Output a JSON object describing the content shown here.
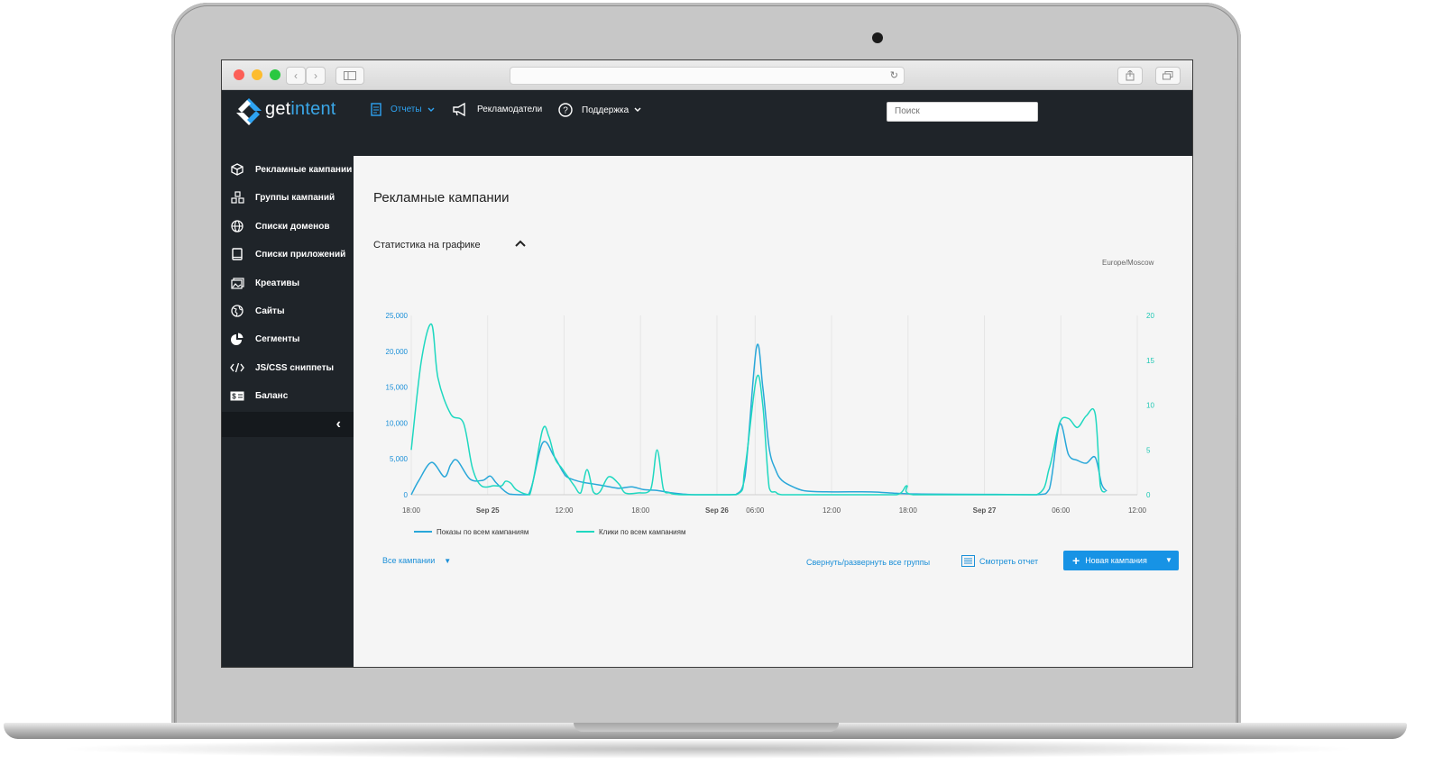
{
  "brand": {
    "name_prefix": "get",
    "name_suffix": "intent"
  },
  "topnav": [
    {
      "label": "Отчеты",
      "icon": "document-icon",
      "active": true,
      "has_dropdown": true
    },
    {
      "label": "Рекламодатели",
      "icon": "megaphone-icon",
      "active": false,
      "has_dropdown": false
    },
    {
      "label": "Поддержка",
      "icon": "help-circle-icon",
      "active": false,
      "has_dropdown": true
    }
  ],
  "search": {
    "placeholder": "Поиск"
  },
  "sidebar": {
    "items": [
      {
        "label": "Рекламные кампании",
        "icon": "cube-icon"
      },
      {
        "label": "Группы кампаний",
        "icon": "cubes-icon"
      },
      {
        "label": "Списки доменов",
        "icon": "globe-icon"
      },
      {
        "label": "Списки приложений",
        "icon": "tablet-icon"
      },
      {
        "label": "Креативы",
        "icon": "image-icon"
      },
      {
        "label": "Сайты",
        "icon": "earth-icon"
      },
      {
        "label": "Сегменты",
        "icon": "pie-icon"
      },
      {
        "label": "JS/CSS сниппеты",
        "icon": "code-icon"
      },
      {
        "label": "Баланс",
        "icon": "money-icon"
      }
    ],
    "collapse_icon": "chevron-left-icon"
  },
  "main": {
    "title": "Рекламные кампании",
    "stats_section_title": "Статистика на графике",
    "timezone": "Europe/Moscow",
    "filter_label": "Все кампании",
    "toggle_groups_label": "Свернуть/развернуть все группы",
    "view_report_label": "Смотреть отчет",
    "new_campaign_label": "Новая кампания"
  },
  "colors": {
    "accent": "#1793e5",
    "series_impressions": "#29a7d9",
    "series_clicks": "#1fd8c0",
    "dark_bg": "#1f2429"
  },
  "chart_data": {
    "type": "line",
    "x_ticks": [
      "18:00",
      "Sep 25",
      "12:00",
      "18:00",
      "Sep 26",
      "06:00",
      "12:00",
      "18:00",
      "Sep 27",
      "06:00",
      "12:00"
    ],
    "x_range_hours": [
      0,
      57
    ],
    "y_left": {
      "ticks": [
        "0",
        "5,000",
        "10,000",
        "15,000",
        "20,000",
        "25,000"
      ],
      "ylim": [
        0,
        25000
      ]
    },
    "y_right": {
      "ticks": [
        "0",
        "5",
        "10",
        "15",
        "20"
      ],
      "ylim": [
        0,
        20
      ]
    },
    "grid": true,
    "legend_position": "bottom-left",
    "series": [
      {
        "name": "Показы по всем кампаниям",
        "axis": "left",
        "points": [
          [
            0,
            0
          ],
          [
            0.6,
            2000
          ],
          [
            1.6,
            4500
          ],
          [
            2.6,
            2500
          ],
          [
            3.1,
            4200
          ],
          [
            3.6,
            4800
          ],
          [
            4.6,
            2200
          ],
          [
            5.6,
            2000
          ],
          [
            6.2,
            2600
          ],
          [
            6.7,
            1600
          ],
          [
            7.7,
            100
          ],
          [
            9.2,
            0
          ],
          [
            10.3,
            7200
          ],
          [
            11.2,
            5400
          ],
          [
            11.9,
            3200
          ],
          [
            12.3,
            2400
          ],
          [
            13.3,
            1800
          ],
          [
            14.3,
            1500
          ],
          [
            15.3,
            1200
          ],
          [
            16.3,
            900
          ],
          [
            17.3,
            1100
          ],
          [
            18.3,
            700
          ],
          [
            19.3,
            600
          ],
          [
            20.3,
            300
          ],
          [
            21.3,
            100
          ],
          [
            22.3,
            0
          ],
          [
            24.5,
            0
          ],
          [
            25.5,
            50
          ],
          [
            26.2,
            2500
          ],
          [
            27.1,
            20500
          ],
          [
            27.6,
            15000
          ],
          [
            28.1,
            6500
          ],
          [
            28.6,
            3500
          ],
          [
            29.1,
            2000
          ],
          [
            30.1,
            1000
          ],
          [
            31.1,
            500
          ],
          [
            33.1,
            400
          ],
          [
            36.1,
            400
          ],
          [
            38.1,
            200
          ],
          [
            40.1,
            100
          ],
          [
            45.1,
            50
          ],
          [
            49.1,
            0
          ],
          [
            50.1,
            800
          ],
          [
            50.9,
            9800
          ],
          [
            51.6,
            5600
          ],
          [
            52.3,
            4800
          ],
          [
            53.0,
            4400
          ],
          [
            53.7,
            5200
          ],
          [
            54.2,
            1500
          ],
          [
            54.6,
            500
          ]
        ]
      },
      {
        "name": "Клики по всем кампаниям",
        "axis": "right",
        "points": [
          [
            0,
            5
          ],
          [
            0.8,
            15
          ],
          [
            1.6,
            19
          ],
          [
            2.1,
            13
          ],
          [
            3.1,
            9
          ],
          [
            4.1,
            8
          ],
          [
            4.8,
            3
          ],
          [
            5.5,
            1
          ],
          [
            6.5,
            1
          ],
          [
            7.1,
            1
          ],
          [
            7.4,
            1.5
          ],
          [
            7.8,
            1.3
          ],
          [
            8.3,
            0.5
          ],
          [
            9.3,
            0
          ],
          [
            10.3,
            7.2
          ],
          [
            10.8,
            6.5
          ],
          [
            11.3,
            4
          ],
          [
            11.8,
            3
          ],
          [
            12.3,
            2
          ],
          [
            12.8,
            1
          ],
          [
            13.3,
            0.2
          ],
          [
            13.8,
            2.8
          ],
          [
            14.3,
            0.3
          ],
          [
            14.8,
            0.3
          ],
          [
            15.5,
            2
          ],
          [
            16.3,
            1.2
          ],
          [
            16.8,
            0.2
          ],
          [
            17.8,
            0.2
          ],
          [
            18.8,
            0.6
          ],
          [
            19.3,
            5
          ],
          [
            19.8,
            0.6
          ],
          [
            20.3,
            0.2
          ],
          [
            21.3,
            0
          ],
          [
            25.5,
            0
          ],
          [
            26.2,
            3
          ],
          [
            27.1,
            13
          ],
          [
            27.6,
            10
          ],
          [
            28.1,
            0.8
          ],
          [
            28.6,
            0.3
          ],
          [
            29.1,
            0
          ],
          [
            31.1,
            0
          ],
          [
            35.1,
            0
          ],
          [
            38.1,
            0
          ],
          [
            38.9,
            1
          ],
          [
            39.4,
            0
          ],
          [
            45.1,
            0
          ],
          [
            49.1,
            0
          ],
          [
            50.1,
            3
          ],
          [
            50.9,
            8
          ],
          [
            51.6,
            8.5
          ],
          [
            52.3,
            7.5
          ],
          [
            53.0,
            8.8
          ],
          [
            53.7,
            9
          ],
          [
            54.1,
            1
          ],
          [
            54.5,
            0.3
          ]
        ]
      }
    ]
  }
}
